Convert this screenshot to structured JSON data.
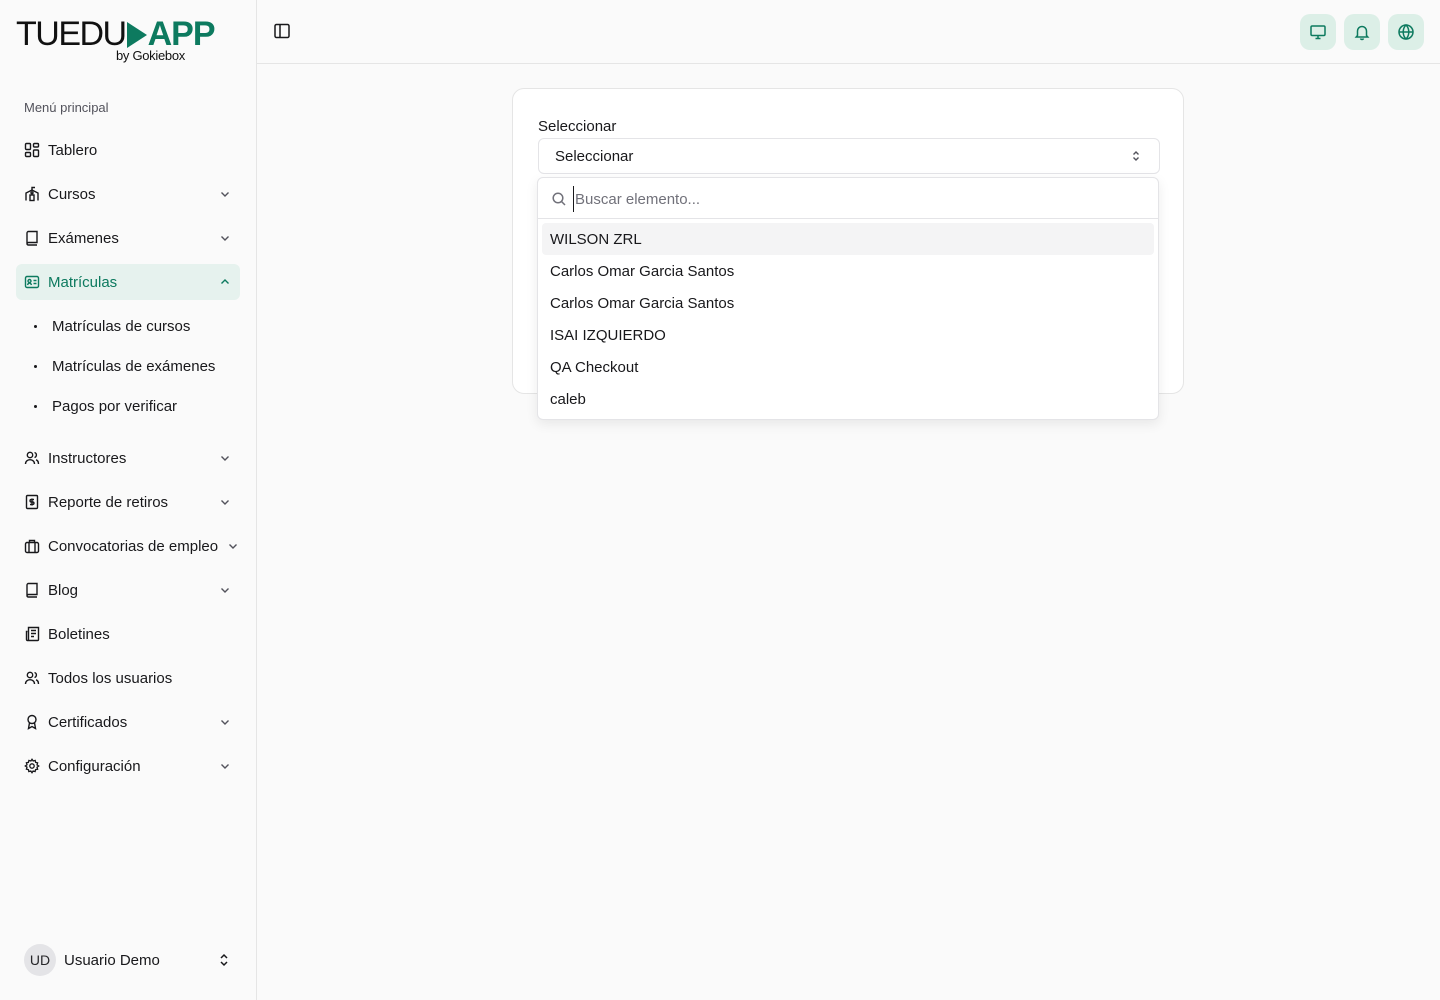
{
  "brand": {
    "logo_main_left": "TUEDU",
    "logo_main_right": "APP",
    "logo_sub": "by Gokiebox",
    "accent": "#0d7a5f"
  },
  "sidebar": {
    "heading": "Menú principal",
    "items": [
      {
        "label": "Tablero",
        "icon": "dashboard-icon"
      },
      {
        "label": "Cursos",
        "icon": "school-icon"
      },
      {
        "label": "Exámenes",
        "icon": "book-icon"
      },
      {
        "label": "Matrículas",
        "icon": "id-card-icon"
      },
      {
        "label": "Instructores",
        "icon": "users-icon"
      },
      {
        "label": "Reporte de retiros",
        "icon": "dollar-receipt-icon"
      },
      {
        "label": "Convocatorias de empleo",
        "icon": "briefcase-icon"
      },
      {
        "label": "Blog",
        "icon": "book-icon"
      },
      {
        "label": "Boletines",
        "icon": "newspaper-icon"
      },
      {
        "label": "Todos los usuarios",
        "icon": "users-icon"
      },
      {
        "label": "Certificados",
        "icon": "award-icon"
      },
      {
        "label": "Configuración",
        "icon": "gear-icon"
      }
    ],
    "subitems": [
      "Matrículas de cursos",
      "Matrículas de exámenes",
      "Pagos por verificar"
    ]
  },
  "user": {
    "initials": "UD",
    "name": "Usuario Demo"
  },
  "form": {
    "label": "Seleccionar",
    "select_value": "Seleccionar",
    "search_placeholder": "Buscar elemento...",
    "options": [
      "WILSON ZRL",
      "Carlos Omar Garcia Santos",
      "Carlos Omar Garcia Santos",
      "ISAI IZQUIERDO",
      "QA Checkout",
      "caleb"
    ]
  }
}
